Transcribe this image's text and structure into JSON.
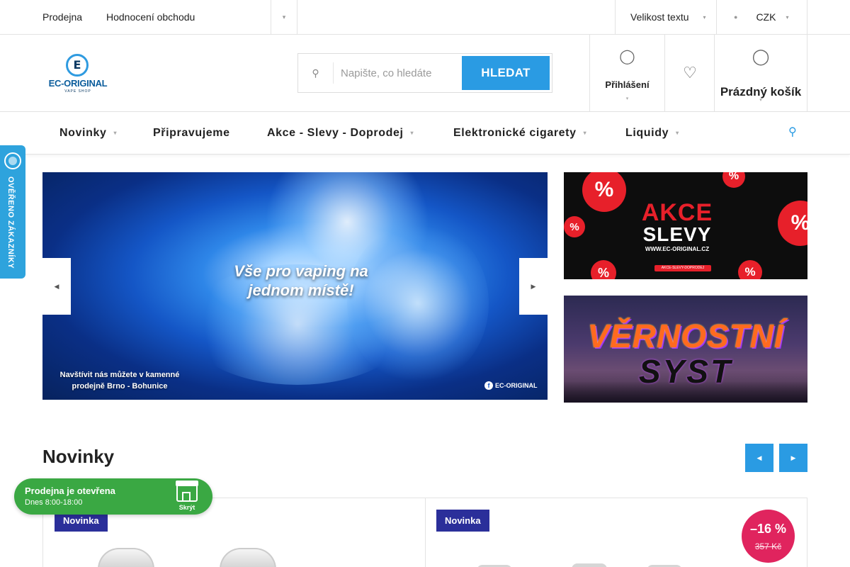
{
  "topbar": {
    "links": [
      "Prodejna",
      "Hodnocení obchodu"
    ],
    "more_icon": "chevron-icon",
    "text_size_label": "Velikost textu",
    "currency": "CZK"
  },
  "header": {
    "logo_name": "EC-ORIGINAL",
    "logo_sub": "VAPE SHOP",
    "logo_letter": "E",
    "search_placeholder": "Napište, co hledáte",
    "search_button": "HLEDAT",
    "login_label": "Přihlášení",
    "cart_label": "Prázdný košík"
  },
  "nav": {
    "items": [
      "Novinky",
      "Připravujeme",
      "Akce - Slevy - Doprodej",
      "Elektronické cigarety",
      "Liquidy"
    ]
  },
  "verified_badge": {
    "label": "OVĚŘENO ZÁKAZNÍKY"
  },
  "hero": {
    "headline_line1": "Vše pro vaping na",
    "headline_line2": "jednom místě!",
    "sub_line1": "Navštívit nás můžete v kamenné",
    "sub_line2": "prodejně Brno - Bohunice",
    "brand": "EC-ORIGINAL",
    "brand_icon": "f"
  },
  "banner_sale": {
    "title1": "AKCE",
    "title2": "SLEVY",
    "url": "WWW.EC-ORIGINAL.CZ",
    "mini": "AKCE-SLEVY-DOPRODEJ",
    "percent": "%"
  },
  "banner_loyalty": {
    "title1": "VĚRNOSTNÍ",
    "title2": "SYST"
  },
  "section": {
    "title": "Novinky"
  },
  "products": [
    {
      "tag": "Novinka"
    },
    {
      "tag": "Novinka",
      "discount": "–16 %",
      "old_price": "357 Kč"
    }
  ],
  "shop_widget": {
    "status": "Prodejna je otevřena",
    "hours": "Dnes 8:00-18:00",
    "hide_label": "Skrýt"
  },
  "colors": {
    "accent": "#2a9be3",
    "tag": "#2b2f9a",
    "discount": "#e0245e",
    "shop_open": "#3aa843"
  }
}
